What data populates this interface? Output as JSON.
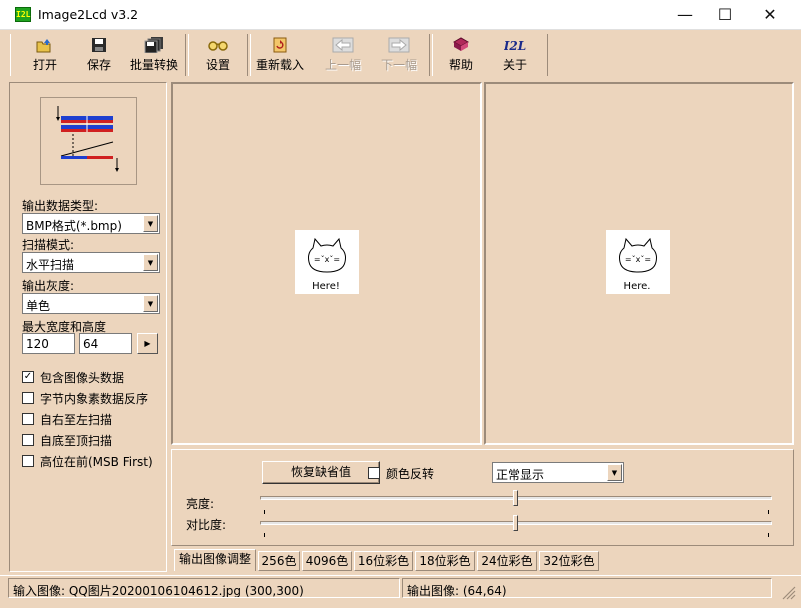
{
  "window": {
    "title": "Image2Lcd v3.2",
    "icon_text": "I2L"
  },
  "toolbar": {
    "open": "打开",
    "save": "保存",
    "batch": "批量转换",
    "settings": "设置",
    "reload": "重新载入",
    "prev": "上一幅",
    "next": "下一幅",
    "help": "帮助",
    "about": "关于"
  },
  "left": {
    "output_type_label": "输出数据类型:",
    "output_type_value": "BMP格式(*.bmp)",
    "scan_mode_label": "扫描模式:",
    "scan_mode_value": "水平扫描",
    "gray_label": "输出灰度:",
    "gray_value": "单色",
    "size_label": "最大宽度和高度",
    "width": "120",
    "height": "64",
    "options": [
      {
        "label": "包含图像头数据",
        "checked": true
      },
      {
        "label": "字节内象素数据反序",
        "checked": false
      },
      {
        "label": "自右至左扫描",
        "checked": false
      },
      {
        "label": "自底至顶扫描",
        "checked": false
      },
      {
        "label": "高位在前(MSB First)",
        "checked": false
      }
    ]
  },
  "images": {
    "input_caption": "Here!",
    "output_caption": "Here."
  },
  "adjust": {
    "restore_label": "恢复缺省值",
    "invert_label": "颜色反转",
    "invert_checked": false,
    "display_mode": "正常显示",
    "brightness_label": "亮度:",
    "brightness_level": 0.5,
    "contrast_label": "对比度:",
    "contrast_level": 0.5
  },
  "tabs": [
    "输出图像调整",
    "256色",
    "4096色",
    "16位彩色",
    "18位彩色",
    "24位彩色",
    "32位彩色"
  ],
  "active_tab": 0,
  "status": {
    "input": "输入图像: QQ图片20200106104612.jpg (300,300)",
    "output": "输出图像: (64,64)"
  }
}
